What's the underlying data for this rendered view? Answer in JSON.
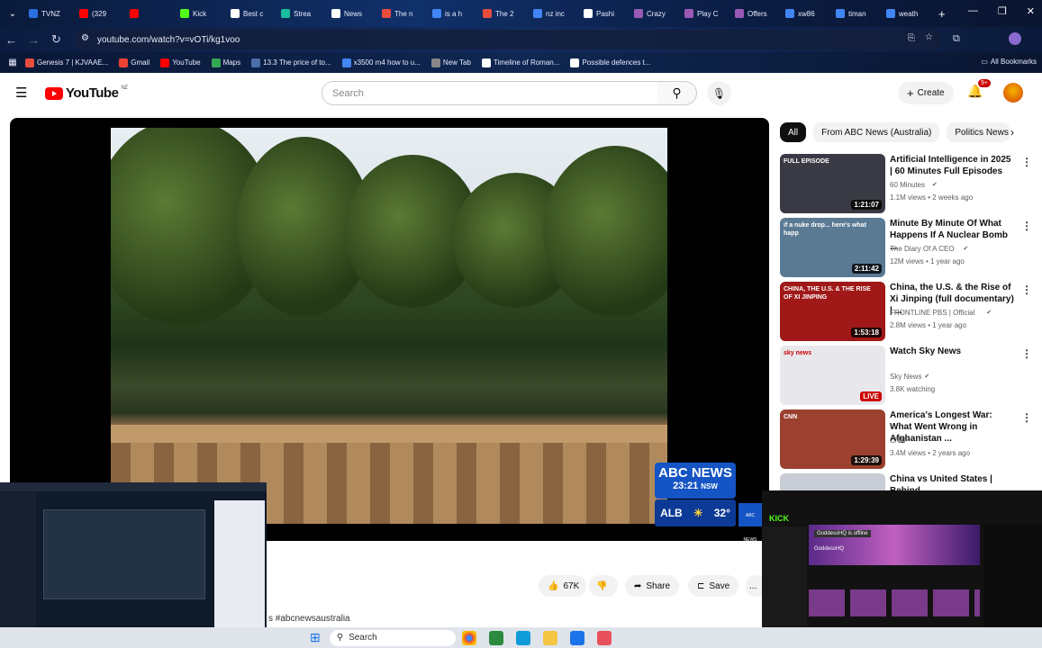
{
  "browser": {
    "tabs": [
      {
        "label": "TVNZ",
        "color": "#2b6ee0"
      },
      {
        "label": "(329",
        "color": "#ff0000"
      },
      {
        "label": "",
        "color": "#ff0000"
      },
      {
        "label": "Kick",
        "color": "#53fc18"
      },
      {
        "label": "Best c",
        "color": "#ffffff"
      },
      {
        "label": "Strea",
        "color": "#1abc9c"
      },
      {
        "label": "News",
        "color": "#ffffff"
      },
      {
        "label": "The n",
        "color": "#e74c3c"
      },
      {
        "label": "is a h",
        "color": "#4285f4"
      },
      {
        "label": "The 2",
        "color": "#e74c3c"
      },
      {
        "label": "nz inc",
        "color": "#4285f4"
      },
      {
        "label": "Pashi",
        "color": "#ffffff"
      },
      {
        "label": "Crazy",
        "color": "#9b59b6"
      },
      {
        "label": "Play C",
        "color": "#9b59b6"
      },
      {
        "label": "Offers",
        "color": "#9b59b6"
      },
      {
        "label": "xw86",
        "color": "#4285f4"
      },
      {
        "label": "timan",
        "color": "#4285f4"
      },
      {
        "label": "weath",
        "color": "#4285f4"
      }
    ],
    "new_tab": "+",
    "url": "youtube.com/watch?v=vOTi/kg1voo",
    "bookmarks": [
      {
        "label": "Genesis 7 | KJVAAE...",
        "color": "#e74c3c"
      },
      {
        "label": "Gmail",
        "color": "#ea4335"
      },
      {
        "label": "YouTube",
        "color": "#ff0000"
      },
      {
        "label": "Maps",
        "color": "#34a853"
      },
      {
        "label": "13.3 The price of to...",
        "color": "#4a6ea9"
      },
      {
        "label": "x3500 m4 how to u...",
        "color": "#4285f4"
      },
      {
        "label": "New Tab",
        "color": "#888888"
      },
      {
        "label": "Timeline of Roman...",
        "color": "#ffffff"
      },
      {
        "label": "Possible defences t...",
        "color": "#ffffff"
      }
    ],
    "all_bookmarks": "All Bookmarks"
  },
  "youtube": {
    "logo_text": "YouTube",
    "logo_region": "NZ",
    "search_placeholder": "Search",
    "create_label": "Create",
    "notif_badge": "9+"
  },
  "player": {
    "news_brand": "ABC NEWS",
    "time": "23:21",
    "tz": "NSW",
    "location": "ALB",
    "temperature": "32°",
    "corner_logo": "ABC NEWS"
  },
  "actions": {
    "likes": "67K",
    "share": "Share",
    "save": "Save",
    "more": "..."
  },
  "hashtag": "s #abcnewsaustralia",
  "chips": [
    "All",
    "From ABC News (Australia)",
    "Politics News"
  ],
  "recommendations": [
    {
      "title": "Artificial Intelligence in 2025 | 60 Minutes Full Episodes",
      "channel": "60 Minutes",
      "meta": "1.1M views • 2 weeks ago",
      "duration": "1:21:07",
      "thumb_label": "FULL EPISODE",
      "thumb_color": "#3a3a44"
    },
    {
      "title": "Minute By Minute Of What Happens If A Nuclear Bomb ...",
      "channel": "The Diary Of A CEO",
      "meta": "12M views • 1 year ago",
      "duration": "2:11:42",
      "thumb_label": "if a nuke drop... here's what happ",
      "thumb_color": "#5a7a94"
    },
    {
      "title": "China, the U.S. & the Rise of Xi Jinping (full documentary) | ...",
      "channel": "FRONTLINE PBS | Official",
      "meta": "2.8M views • 1 year ago",
      "duration": "1:53:18",
      "thumb_label": "CHINA, THE U.S. & THE RISE OF XI JINPING",
      "thumb_color": "#a01818"
    },
    {
      "title": "Watch Sky News",
      "channel": "Sky News",
      "meta": "3.8K watching",
      "duration": "LIVE",
      "thumb_label": "sky news",
      "thumb_color": "#e8e8ec"
    },
    {
      "title": "America's Longest War: What Went Wrong in Afghanistan ...",
      "channel": "CNN",
      "meta": "3.4M views • 2 years ago",
      "duration": "1:29:39",
      "thumb_label": "CNN",
      "thumb_color": "#9c4030"
    },
    {
      "title": "China vs United States | Behind",
      "channel": "",
      "meta": "",
      "duration": "",
      "thumb_label": "",
      "thumb_color": "#c8ccd4"
    }
  ],
  "taskbar": {
    "search": "Search"
  },
  "right_overlay": {
    "brand": "KICK",
    "status": "GoddessHQ is offline",
    "channel": "GoddessHQ"
  }
}
